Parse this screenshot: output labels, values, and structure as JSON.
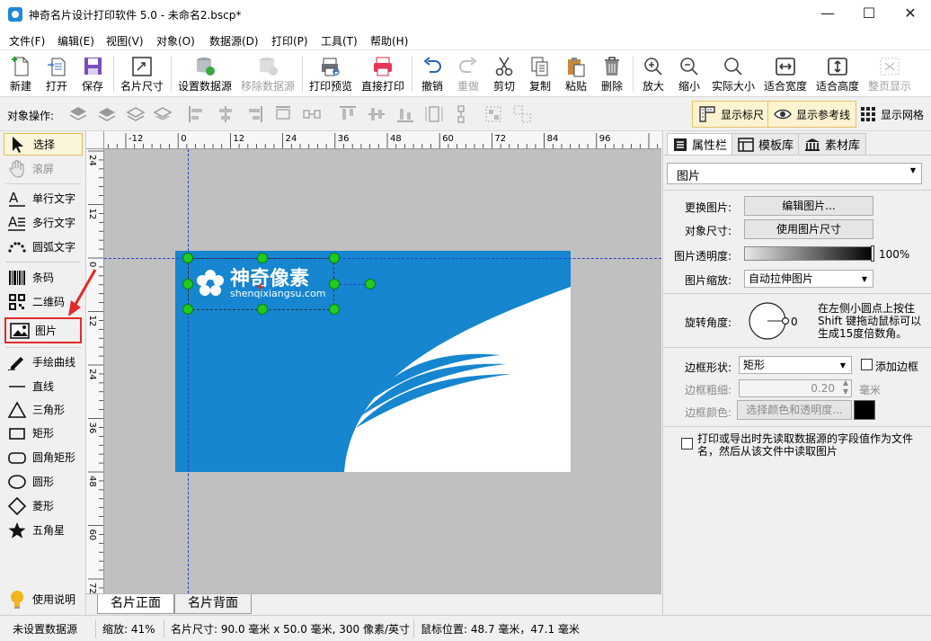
{
  "window": {
    "title": "神奇名片设计打印软件 5.0 - 未命名2.bscp*",
    "min_glyph": "—",
    "max_glyph": "☐",
    "close_glyph": "✕"
  },
  "menu": [
    "文件(F)",
    "编辑(E)",
    "视图(V)",
    "对象(O)",
    "数据源(D)",
    "打印(P)",
    "工具(T)",
    "帮助(H)"
  ],
  "toolbar": {
    "new": "新建",
    "open": "打开",
    "save": "保存",
    "card_size": "名片尺寸",
    "set_datasource": "设置数据源",
    "remove_datasource": "移除数据源",
    "print_preview": "打印预览",
    "direct_print": "直接打印",
    "undo": "撤销",
    "redo": "重做",
    "cut": "剪切",
    "copy": "复制",
    "paste": "粘贴",
    "delete": "删除",
    "zoom_in": "放大",
    "zoom_out": "缩小",
    "actual_size": "实际大小",
    "fit_width": "适合宽度",
    "fit_height": "适合高度",
    "fit_page": "整页显示"
  },
  "objbar": {
    "label": "对象操作:",
    "show_ruler": "显示标尺",
    "show_guides": "显示参考线",
    "show_grid": "显示网格"
  },
  "tools": {
    "select": "选择",
    "scroll": "滚屏",
    "single_text": "单行文字",
    "multi_text": "多行文字",
    "arc_text": "圆弧文字",
    "barcode": "条码",
    "qrcode": "二维码",
    "image": "图片",
    "freehand": "手绘曲线",
    "line": "直线",
    "triangle": "三角形",
    "rect": "矩形",
    "round_rect": "圆角矩形",
    "circle": "圆形",
    "diamond": "菱形",
    "star": "五角星",
    "help": "使用说明"
  },
  "ruler": {
    "h_labels": [
      "-12",
      "0",
      "12",
      "24",
      "36",
      "48",
      "60",
      "72",
      "84",
      "96"
    ],
    "v_labels": [
      "24",
      "12",
      "0",
      "12",
      "24",
      "36",
      "48",
      "60",
      "72"
    ]
  },
  "card": {
    "logo_cn": "神奇像素",
    "logo_en": "shenqixiangsu.com",
    "colors": {
      "primary": "#1586cf",
      "white": "#ffffff"
    }
  },
  "page_tabs": {
    "front": "名片正面",
    "back": "名片背面"
  },
  "right_panel": {
    "tabs": {
      "properties": "属性栏",
      "templates": "模板库",
      "materials": "素材库"
    },
    "object_type": "图片",
    "change_image_label": "更换图片:",
    "edit_image_btn": "编辑图片...",
    "object_size_label": "对象尺寸:",
    "use_image_size_btn": "使用图片尺寸",
    "opacity_label": "图片透明度:",
    "opacity_value": "100%",
    "scale_label": "图片缩放:",
    "scale_value": "自动拉伸图片",
    "rotation_label": "旋转角度:",
    "rotation_value": "0",
    "rotation_hint": "在左侧小圆点上按住Shift 键拖动鼠标可以生成15度倍数角。",
    "border_shape_label": "边框形状:",
    "border_shape_value": "矩形",
    "add_border_label": "添加边框",
    "border_width_label": "边框粗细:",
    "border_width_value": "0.20",
    "border_width_unit": "毫米",
    "border_color_label": "边框颜色:",
    "border_color_btn": "选择颜色和透明度...",
    "border_color_swatch": "#000000",
    "print_note": "打印或导出时先读取数据源的字段值作为文件名，然后从该文件中读取图片"
  },
  "status": {
    "datasource": "未设置数据源",
    "zoom": "缩放: 41%",
    "card_size": "名片尺寸: 90.0 毫米 x 50.0 毫米, 300 像素/英寸",
    "mouse": "鼠标位置: 48.7 毫米，47.1 毫米"
  }
}
